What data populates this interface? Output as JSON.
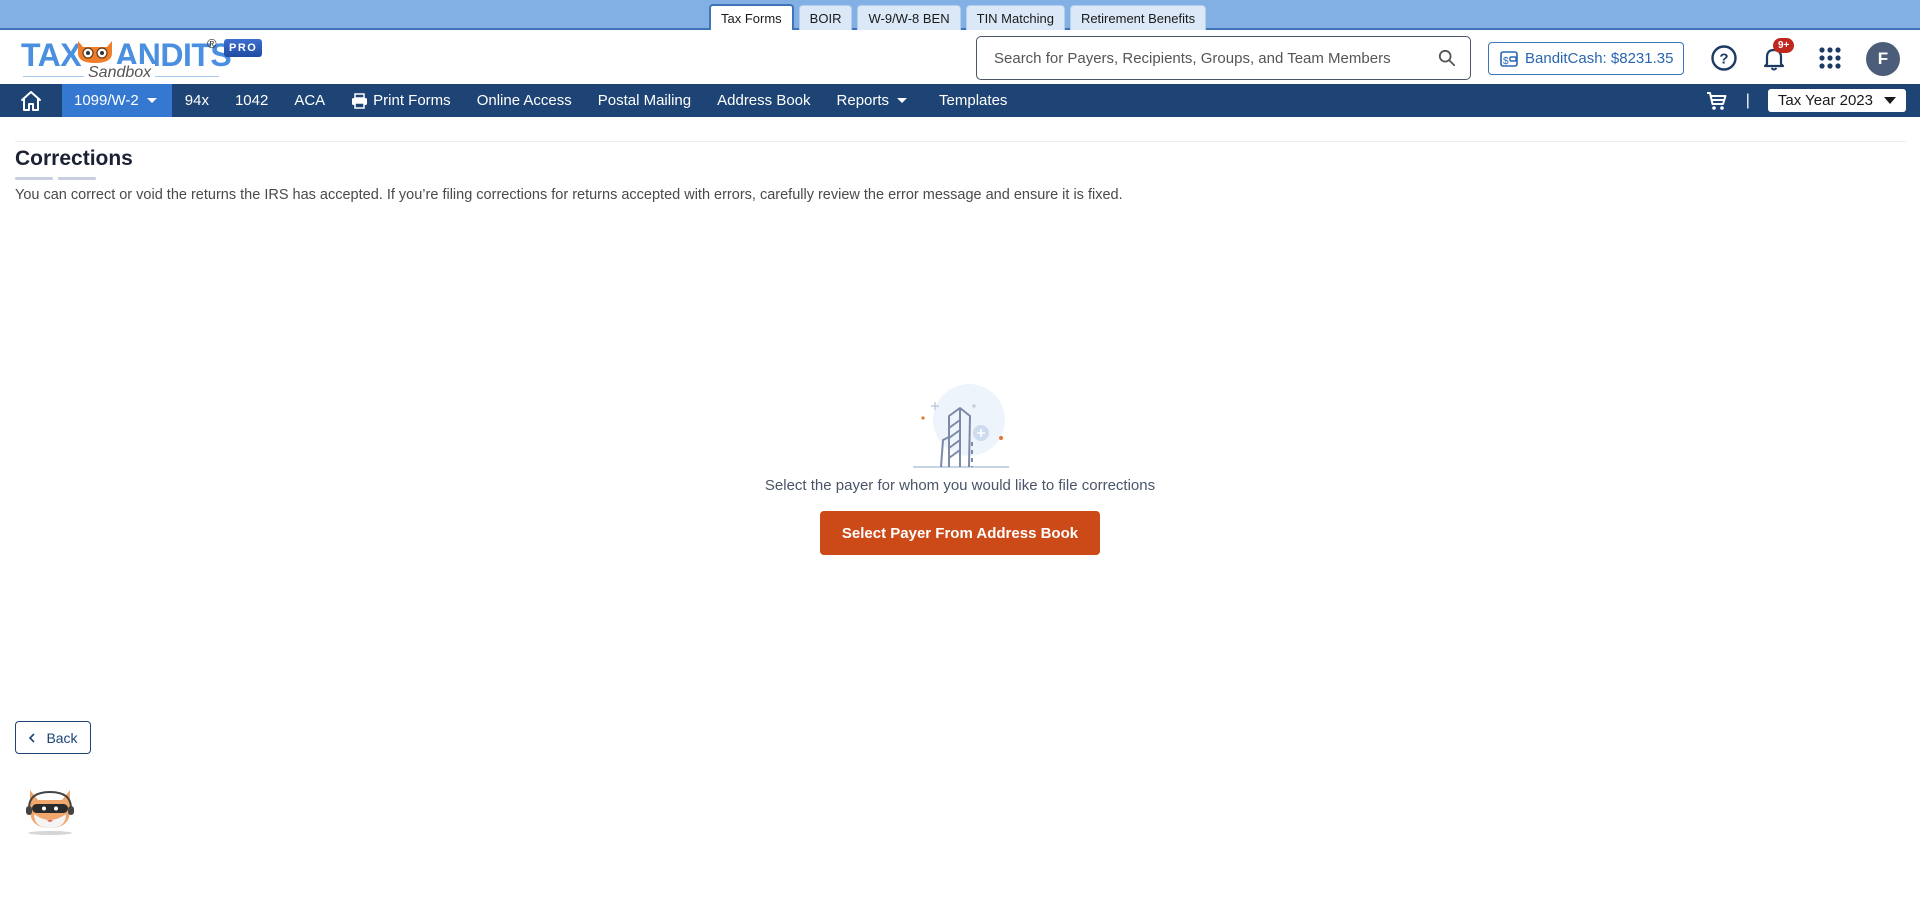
{
  "product_tabs": [
    {
      "label": "Tax Forms",
      "active": true
    },
    {
      "label": "BOIR",
      "active": false
    },
    {
      "label": "W-9/W-8 BEN",
      "active": false
    },
    {
      "label": "TIN Matching",
      "active": false
    },
    {
      "label": "Retirement Benefits",
      "active": false
    }
  ],
  "header": {
    "logo_text": "TAXBANDITS",
    "logo_reg": "®",
    "logo_badge": "PRO",
    "logo_sub": "Sandbox",
    "search_placeholder": "Search for Payers, Recipients, Groups, and Team Members",
    "bandit_cash": "BanditCash: $8231.35",
    "notification_count": "9+",
    "avatar_initial": "F"
  },
  "nav": {
    "items": [
      {
        "label": "1099/W-2",
        "active": true,
        "dropdown": true
      },
      {
        "label": "94x"
      },
      {
        "label": "1042"
      },
      {
        "label": "ACA"
      },
      {
        "label": "Print Forms",
        "icon": "printer-icon"
      },
      {
        "label": "Online Access"
      },
      {
        "label": "Postal Mailing"
      },
      {
        "label": "Address Book"
      },
      {
        "label": "Reports",
        "dropdown": true
      },
      {
        "label": "Templates"
      }
    ],
    "separator": "|",
    "tax_year": "Tax Year 2023"
  },
  "main": {
    "title": "Corrections",
    "description": "You can correct or void the returns the IRS has accepted. If you’re filing corrections for returns accepted with errors, carefully review the error message and ensure it is fixed.",
    "empty_message": "Select the payer for whom you would like to file corrections",
    "primary_button": "Select Payer From Address Book",
    "back_button": "Back"
  },
  "colors": {
    "nav_bg": "#1d4474",
    "nav_active": "#3478d1",
    "accent_orange": "#cc4a17",
    "top_strip": "#82b0e4"
  }
}
